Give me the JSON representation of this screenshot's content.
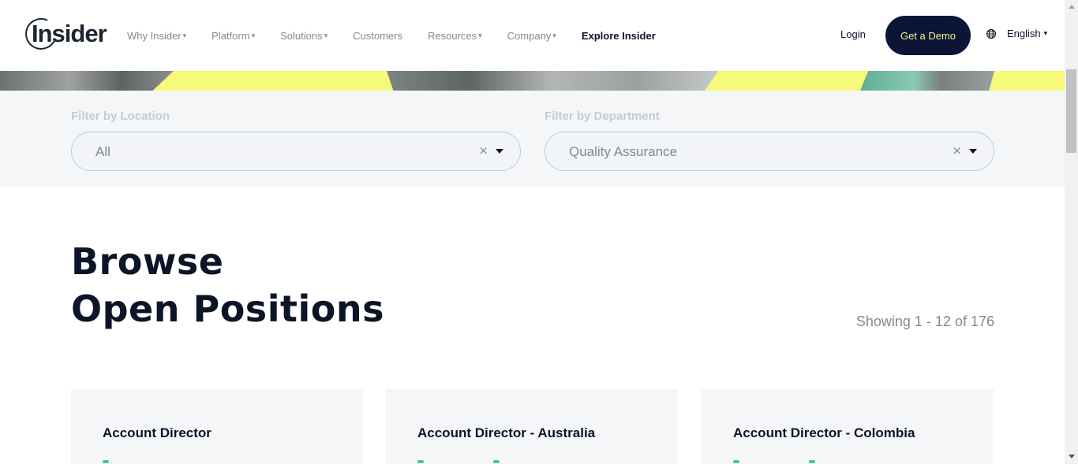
{
  "header": {
    "logo": "Insider",
    "nav": [
      {
        "label": "Why Insider",
        "caret": "▾"
      },
      {
        "label": "Platform",
        "caret": "▾"
      },
      {
        "label": "Solutions",
        "caret": "▾"
      },
      {
        "label": "Customers",
        "caret": ""
      },
      {
        "label": "Resources",
        "caret": "▾"
      },
      {
        "label": "Company",
        "caret": "▾"
      },
      {
        "label": "Explore Insider",
        "caret": ""
      }
    ],
    "login": "Login",
    "cta": "Get a Demo",
    "language": "English",
    "language_caret": "▾",
    "globe_icon": "globe-icon"
  },
  "filters": {
    "location": {
      "label": "Filter by Location",
      "value": "All",
      "clear": "×"
    },
    "department": {
      "label": "Filter by Department",
      "value": "Quality Assurance",
      "clear": "×"
    }
  },
  "browse": {
    "title_line1": "Browse",
    "title_line2": "Open Positions",
    "showing": "Showing 1 - 12 of 176"
  },
  "jobs": [
    {
      "title": "Account Director"
    },
    {
      "title": "Account Director - Australia"
    },
    {
      "title": "Account Director - Colombia"
    }
  ],
  "colors": {
    "brand_dark": "#0c1427",
    "cta_bg": "#0c1536",
    "cta_text": "#f5f78a",
    "hero_yellow": "#f6f97a",
    "accent_teal": "#4fc1a3"
  }
}
